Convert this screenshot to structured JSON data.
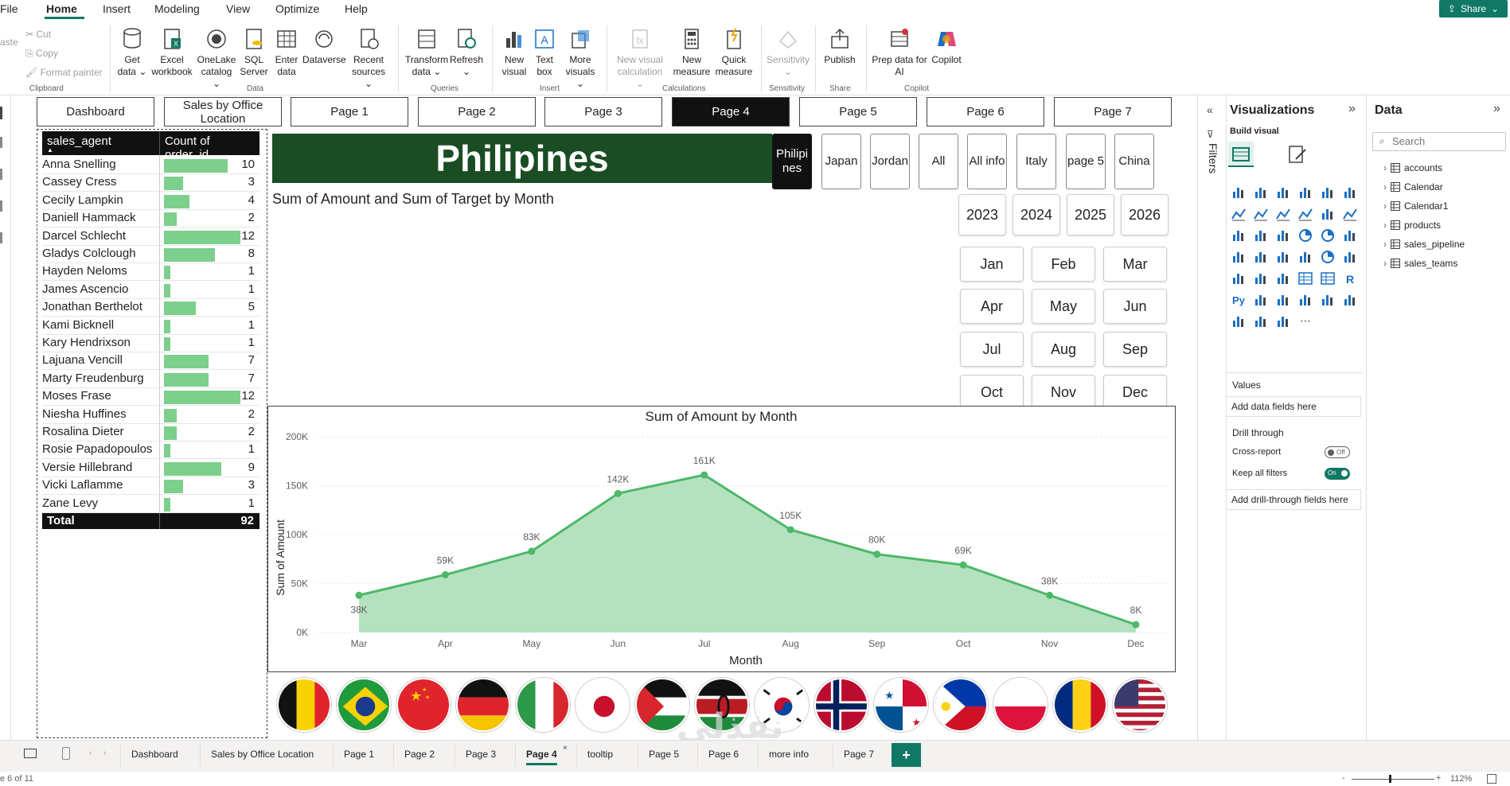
{
  "menu": [
    "File",
    "Home",
    "Insert",
    "Modeling",
    "View",
    "Optimize",
    "Help"
  ],
  "share_label": "Share",
  "ribbon": {
    "clipboard": {
      "cut": "Cut",
      "copy": "Copy",
      "format_painter": "Format painter",
      "paste_partial": "aste",
      "group": "Clipboard"
    },
    "data": {
      "get_data": "Get data",
      "excel": "Excel workbook",
      "onelake": "OneLake catalog",
      "sql": "SQL Server",
      "enter": "Enter data",
      "dataverse": "Dataverse",
      "recent": "Recent sources",
      "group": "Data"
    },
    "queries": {
      "transform": "Transform data",
      "refresh": "Refresh",
      "group": "Queries"
    },
    "insert": {
      "new_visual": "New visual",
      "text_box": "Text box",
      "more_visuals": "More visuals",
      "group": "Insert"
    },
    "calculations": {
      "new_visual_calc": "New visual calculation",
      "new_measure": "New measure",
      "quick_measure": "Quick measure",
      "group": "Calculations"
    },
    "sensitivity": {
      "label": "Sensitivity",
      "group": "Sensitivity"
    },
    "share": {
      "publish": "Publish",
      "group": "Share"
    },
    "copilot": {
      "prep": "Prep data for AI",
      "copilot": "Copilot",
      "group": "Copilot"
    }
  },
  "nav_buttons": [
    "Dashboard",
    "Sales by Office Location",
    "Page 1",
    "Page 2",
    "Page 3",
    "Page 4",
    "Page 5",
    "Page 6",
    "Page 7"
  ],
  "nav_active": "Page 4",
  "matrix": {
    "col1": "sales_agent",
    "col2": "Count of order_id",
    "rows": [
      {
        "name": "Anna Snelling",
        "value": 10
      },
      {
        "name": "Cassey Cress",
        "value": 3
      },
      {
        "name": "Cecily Lampkin",
        "value": 4
      },
      {
        "name": "Daniell Hammack",
        "value": 2
      },
      {
        "name": "Darcel Schlecht",
        "value": 12
      },
      {
        "name": "Gladys Colclough",
        "value": 8
      },
      {
        "name": "Hayden Neloms",
        "value": 1
      },
      {
        "name": "James Ascencio",
        "value": 1
      },
      {
        "name": "Jonathan Berthelot",
        "value": 5
      },
      {
        "name": "Kami Bicknell",
        "value": 1
      },
      {
        "name": "Kary Hendrixson",
        "value": 1
      },
      {
        "name": "Lajuana Vencill",
        "value": 7
      },
      {
        "name": "Marty Freudenburg",
        "value": 7
      },
      {
        "name": "Moses Frase",
        "value": 12
      },
      {
        "name": "Niesha Huffines",
        "value": 2
      },
      {
        "name": "Rosalina Dieter",
        "value": 2
      },
      {
        "name": "Rosie Papadopoulos",
        "value": 1
      },
      {
        "name": "Versie Hillebrand",
        "value": 9
      },
      {
        "name": "Vicki Laflamme",
        "value": 3
      },
      {
        "name": "Zane Levy",
        "value": 1
      }
    ],
    "total_label": "Total",
    "total_value": 92
  },
  "banner_title": "Philipines",
  "top_chart_title": "Sum of Amount and Sum of Target by Month",
  "country_slicer": [
    "Philipines",
    "Japan",
    "Jordan",
    "All",
    "All info",
    "Italy",
    "page 5",
    "China"
  ],
  "country_selected": "Philipines",
  "years": [
    "2023",
    "2024",
    "2025",
    "2026"
  ],
  "months": [
    "Jan",
    "Feb",
    "Mar",
    "Apr",
    "May",
    "Jun",
    "Jul",
    "Aug",
    "Sep",
    "Oct",
    "Nov",
    "Dec"
  ],
  "chart_data": {
    "type": "area",
    "title": "Sum of Amount by Month",
    "xlabel": "Month",
    "ylabel": "Sum of Amount",
    "categories": [
      "Mar",
      "Apr",
      "May",
      "Jun",
      "Jul",
      "Aug",
      "Sep",
      "Oct",
      "Nov",
      "Dec"
    ],
    "values": [
      38000,
      59000,
      83000,
      142000,
      161000,
      105000,
      80000,
      69000,
      38000,
      8000
    ],
    "data_labels": [
      "38K",
      "59K",
      "83K",
      "142K",
      "161K",
      "105K",
      "80K",
      "69K",
      "38K",
      "8K"
    ],
    "yticks": [
      "0K",
      "50K",
      "100K",
      "150K",
      "200K"
    ],
    "ylim": [
      0,
      200000
    ],
    "color": "#4db868",
    "fill": "#b4e2bf"
  },
  "flags": [
    "belgium",
    "brazil",
    "china",
    "germany",
    "italy",
    "japan",
    "jordan",
    "kenya",
    "south-korea",
    "norway",
    "panama",
    "philippines",
    "poland",
    "romania",
    "usa"
  ],
  "filters_label": "Filters",
  "visualizations": {
    "title": "Visualizations",
    "build_visual": "Build visual",
    "values_label": "Values",
    "add_data": "Add data fields here",
    "drill_through": "Drill through",
    "cross_report": "Cross-report",
    "cross_report_state": "Off",
    "keep_filters": "Keep all filters",
    "keep_filters_state": "On",
    "add_drill": "Add drill-through fields here"
  },
  "data_pane": {
    "title": "Data",
    "search_placeholder": "Search",
    "tables": [
      "accounts",
      "Calendar",
      "Calendar1",
      "products",
      "sales_pipeline",
      "sales_teams"
    ]
  },
  "page_tabs": [
    "Dashboard",
    "Sales by Office Location",
    "Page 1",
    "Page 2",
    "Page 3",
    "Page 4",
    "tooltip",
    "Page 5",
    "Page 6",
    "more info",
    "Page 7"
  ],
  "page_tab_active": "Page 4",
  "add_page": "+",
  "status": {
    "page_count": "e 6 of 11",
    "zoom": "112%",
    "minus": "-",
    "plus": "+"
  }
}
